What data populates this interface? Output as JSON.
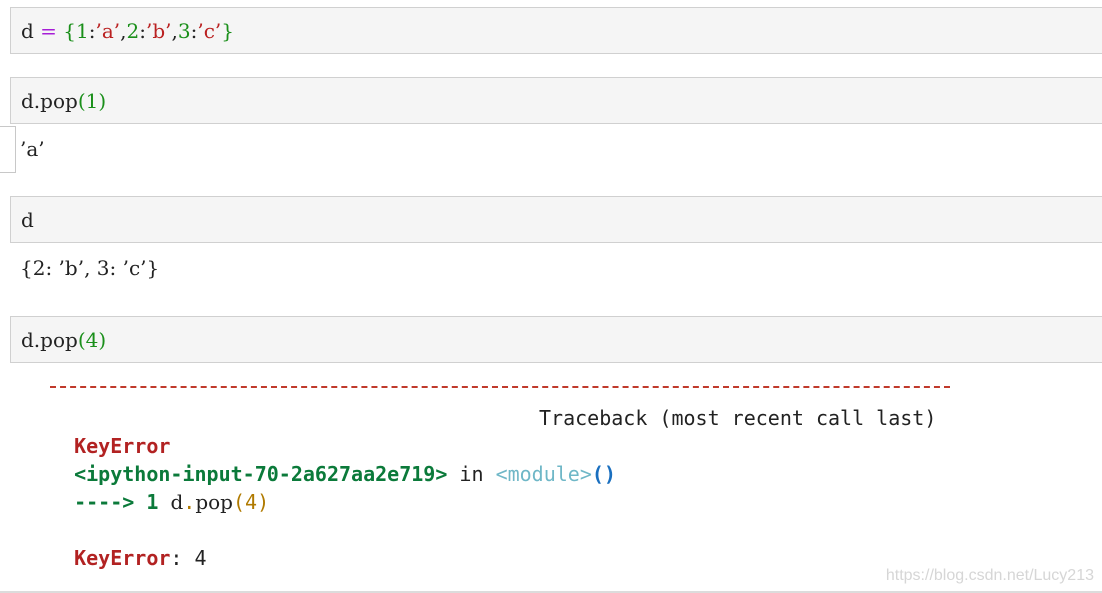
{
  "cells": [
    {
      "input_tokens": [
        {
          "t": "d",
          "c": "var"
        },
        {
          "t": " ",
          "c": "var"
        },
        {
          "t": "=",
          "c": "op"
        },
        {
          "t": " ",
          "c": "var"
        },
        {
          "t": "{",
          "c": "brace"
        },
        {
          "t": "1",
          "c": "num"
        },
        {
          "t": ":",
          "c": "var"
        },
        {
          "t": "’a’",
          "c": "str"
        },
        {
          "t": ",",
          "c": "var"
        },
        {
          "t": "2",
          "c": "num"
        },
        {
          "t": ":",
          "c": "var"
        },
        {
          "t": "’b’",
          "c": "str"
        },
        {
          "t": ",",
          "c": "var"
        },
        {
          "t": "3",
          "c": "num"
        },
        {
          "t": ":",
          "c": "var"
        },
        {
          "t": "’c’",
          "c": "str"
        },
        {
          "t": "}",
          "c": "brace"
        }
      ]
    },
    {
      "input_tokens": [
        {
          "t": "d.pop",
          "c": "var"
        },
        {
          "t": "(",
          "c": "paren"
        },
        {
          "t": "1",
          "c": "num"
        },
        {
          "t": ")",
          "c": "paren"
        }
      ],
      "output": "’a’"
    },
    {
      "input_tokens": [
        {
          "t": "d",
          "c": "var"
        }
      ],
      "output": "{2: ’b’, 3: ’c’}"
    },
    {
      "input_tokens": [
        {
          "t": "d.pop",
          "c": "var"
        },
        {
          "t": "(",
          "c": "paren"
        },
        {
          "t": "4",
          "c": "num"
        },
        {
          "t": ")",
          "c": "paren"
        }
      ]
    }
  ],
  "traceback": {
    "error_name": "KeyError",
    "traceback_label": "Traceback (most recent call last)",
    "file_ref": "<ipython-input-70-2a627aa2e719>",
    "in_word": "in",
    "module": "<module>",
    "module_parens": "()",
    "arrow": "---->",
    "line_no": "1",
    "code_name": "d",
    "code_dot": ".",
    "code_method": "pop",
    "code_open": "(",
    "code_arg": "4",
    "code_close": ")",
    "final_error_name": "KeyError",
    "final_message": ": 4"
  },
  "watermark": "https://blog.csdn.net/Lucy213"
}
